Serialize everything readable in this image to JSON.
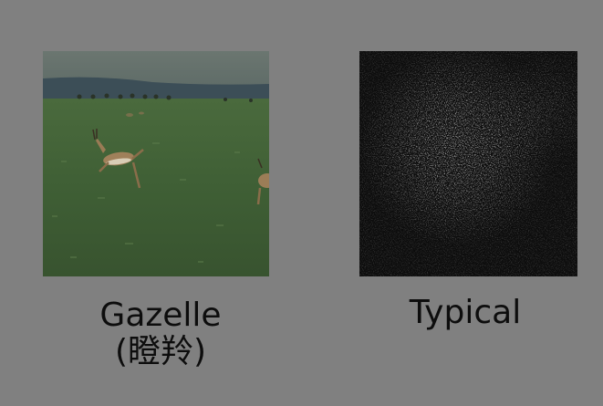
{
  "images": [
    {
      "caption_lines": [
        "Gazelle",
        "(瞪羚)"
      ]
    },
    {
      "caption": "Typical"
    }
  ],
  "colors": {
    "background": "#808080",
    "caption_text": "#0d0d0d",
    "sky": "#66716a",
    "grass": "#3e5a34",
    "map_background": "#0c0c0c"
  }
}
